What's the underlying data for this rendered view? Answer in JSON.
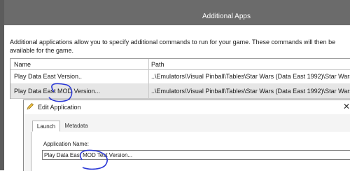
{
  "header": {
    "title": "Additional Apps"
  },
  "description": "Additional applications allow you to specify additional commands to run for your game.  These commands will then be available for the game.",
  "grid": {
    "columns": [
      "Name",
      "Path"
    ],
    "rows": [
      {
        "name": "Play Data East Version..",
        "path": "..\\Emulators\\Visual Pinball\\Tables\\Star Wars (Data East 1992)\\Star Wars (Da"
      },
      {
        "name": "Play Data East MOD Version...",
        "path": "..\\Emulators\\Visual Pinball\\Tables\\Star Wars (Data East 1992)\\Star Wars (Da"
      }
    ]
  },
  "dialog": {
    "title": "Edit Application",
    "icon": "pencil-icon",
    "close_icon": "close-icon",
    "tabs": [
      "Launch",
      "Metadata"
    ],
    "active_tab": "Launch",
    "application_name_label": "Application Name:",
    "application_name_value": "Play Data East MOD Test Version..."
  },
  "colors": {
    "header_bg": "#6b6b6b",
    "annotation": "#2b38d6",
    "selected_row": "#e6e6e6"
  }
}
